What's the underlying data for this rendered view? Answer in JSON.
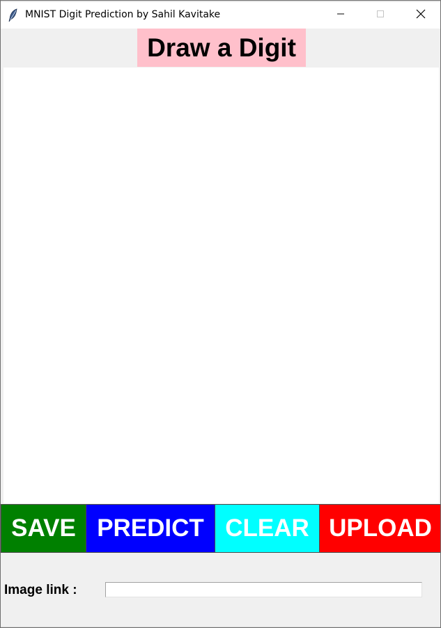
{
  "window": {
    "title": "MNIST Digit Prediction by Sahil Kavitake",
    "icon": "feather-icon",
    "controls": [
      "minimize-icon",
      "maximize-icon",
      "close-icon"
    ]
  },
  "heading": {
    "text": "Draw a Digit",
    "background": "#ffc0cb"
  },
  "canvas": {
    "background": "#ffffff"
  },
  "buttons": {
    "save": {
      "label": "SAVE",
      "color": "#008000"
    },
    "predict": {
      "label": "PREDICT",
      "color": "#0000ff"
    },
    "clear": {
      "label": "CLEAR",
      "color": "#00ffff"
    },
    "upload": {
      "label": "UPLOAD",
      "color": "#ff0000"
    }
  },
  "image_link": {
    "label": "Image link :",
    "value": ""
  }
}
